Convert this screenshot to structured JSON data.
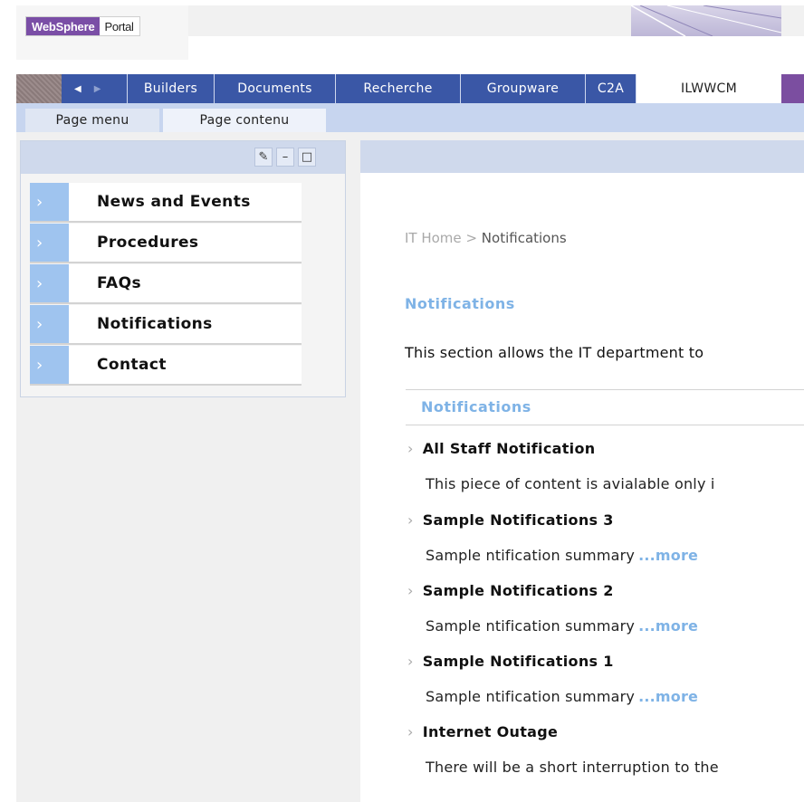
{
  "header": {
    "logo_brand": "WebSphere",
    "logo_product": "Portal"
  },
  "nav": {
    "prev_arrow": "◀",
    "next_arrow": "▶",
    "tabs": [
      {
        "label": "Builders"
      },
      {
        "label": "Documents"
      },
      {
        "label": "Recherche"
      },
      {
        "label": "Groupware"
      },
      {
        "label": "C2A"
      },
      {
        "label": "ILWWCM",
        "active": true
      }
    ]
  },
  "subnav": {
    "tabs": [
      {
        "label": "Page menu"
      },
      {
        "label": "Page contenu",
        "active": true
      }
    ]
  },
  "left_portlet": {
    "controls": {
      "edit": "✎",
      "minimize": "–",
      "maximize": "□"
    },
    "menu": [
      {
        "label": "News and Events"
      },
      {
        "label": "Procedures"
      },
      {
        "label": "FAQs"
      },
      {
        "label": "Notifications"
      },
      {
        "label": "Contact"
      }
    ]
  },
  "content": {
    "breadcrumb": {
      "home": "IT Home",
      "separator": ">",
      "current": "Notifications"
    },
    "title": "Notifications",
    "description": "This section allows the IT department to",
    "list_header": "Notifications",
    "items": [
      {
        "title": "All Staff Notification",
        "summary": "This piece of content is avialable only i",
        "more": ""
      },
      {
        "title": "Sample Notifications 3",
        "summary": "Sample ntification summary",
        "more": "...more"
      },
      {
        "title": "Sample Notifications 2",
        "summary": "Sample ntification summary",
        "more": "...more"
      },
      {
        "title": "Sample Notifications 1",
        "summary": "Sample ntification summary",
        "more": "...more"
      },
      {
        "title": "Internet Outage",
        "summary": "There will be a short interruption to the",
        "more": ""
      }
    ]
  },
  "colors": {
    "nav_blue": "#3a57a6",
    "brand_purple": "#7a4ea6",
    "link_blue": "#7fb3e6",
    "menu_arrow_blue": "#9fc4ef"
  }
}
